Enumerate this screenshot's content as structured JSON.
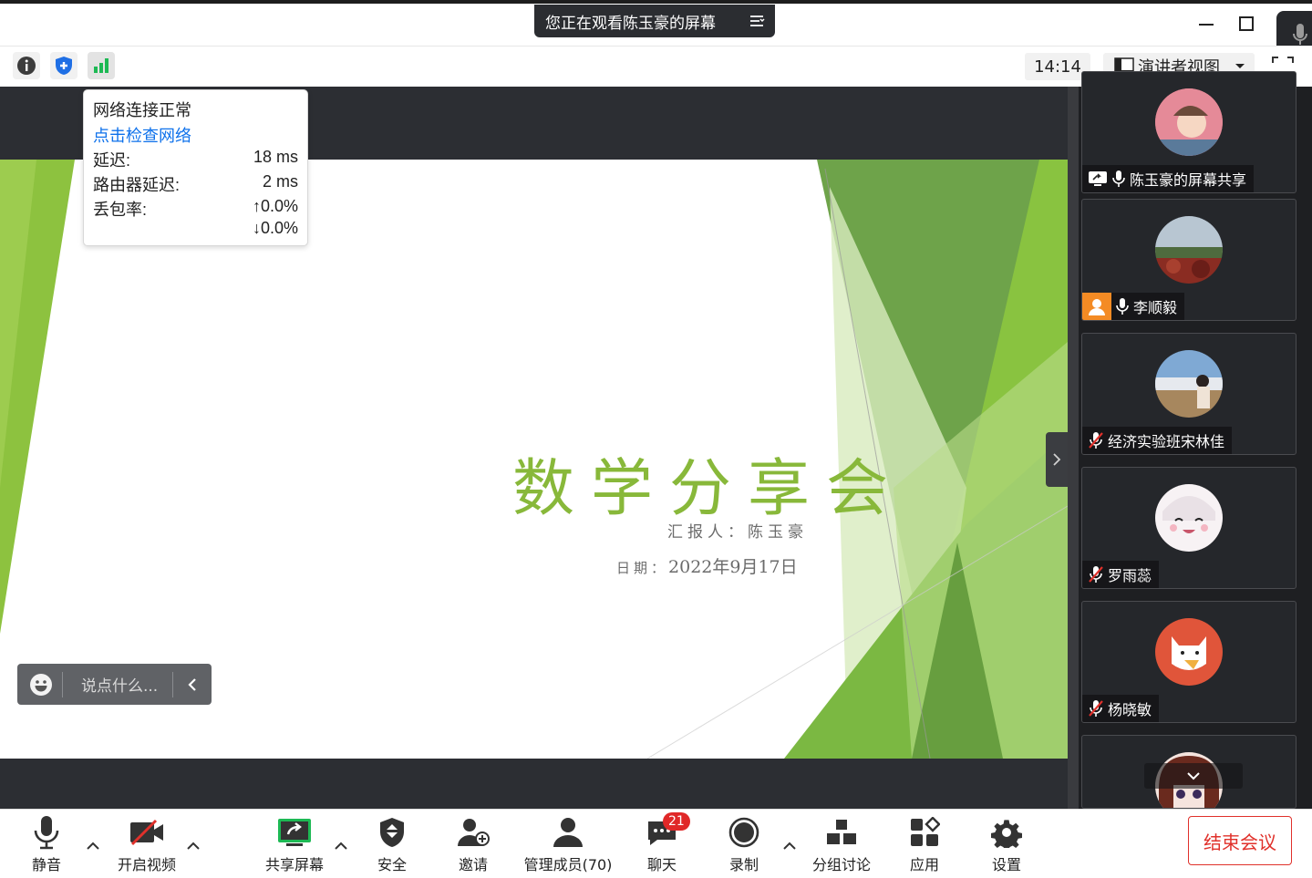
{
  "window": {
    "viewing_text": "您正在观看陈玉豪的屏幕",
    "minimize_icon": "minimize-icon",
    "maximize_icon": "maximize-icon"
  },
  "infobar": {
    "time": "14:14",
    "view_label": "演讲者视图"
  },
  "network_popup": {
    "status": "网络连接正常",
    "check_link": "点击检查网络",
    "latency_label": "延迟:",
    "latency_value": "18 ms",
    "router_label": "路由器延迟:",
    "router_value": "2 ms",
    "loss_label": "丢包率:",
    "loss_up": "↑0.0%",
    "loss_down": "↓0.0%"
  },
  "slide": {
    "title": "数学分享会",
    "reporter": "汇报人：陈玉豪",
    "date_label": "日期：",
    "date_value": "2022年9月17日"
  },
  "chat_input": {
    "placeholder": "说点什么..."
  },
  "participants": [
    {
      "name": "陈玉豪的屏幕共享",
      "muted": false,
      "sharing": true
    },
    {
      "name": "李顺毅",
      "muted": false,
      "sharing": false
    },
    {
      "name": "经济实验班宋林佳",
      "muted": true,
      "sharing": false
    },
    {
      "name": "罗雨蕊",
      "muted": true,
      "sharing": false
    },
    {
      "name": "杨晓敏",
      "muted": true,
      "sharing": false
    },
    {
      "name": "",
      "muted": true,
      "sharing": false
    }
  ],
  "toolbar": {
    "mute": "静音",
    "video": "开启视频",
    "share": "共享屏幕",
    "security": "安全",
    "invite": "邀请",
    "participants": "管理成员(70)",
    "chat": "聊天",
    "chat_badge": "21",
    "record": "录制",
    "breakout": "分组讨论",
    "apps": "应用",
    "settings": "设置",
    "end": "结束会议"
  },
  "colors": {
    "accent_green": "#88b83a",
    "end_red": "#e0312b",
    "stage_dark": "#2c2e33"
  }
}
